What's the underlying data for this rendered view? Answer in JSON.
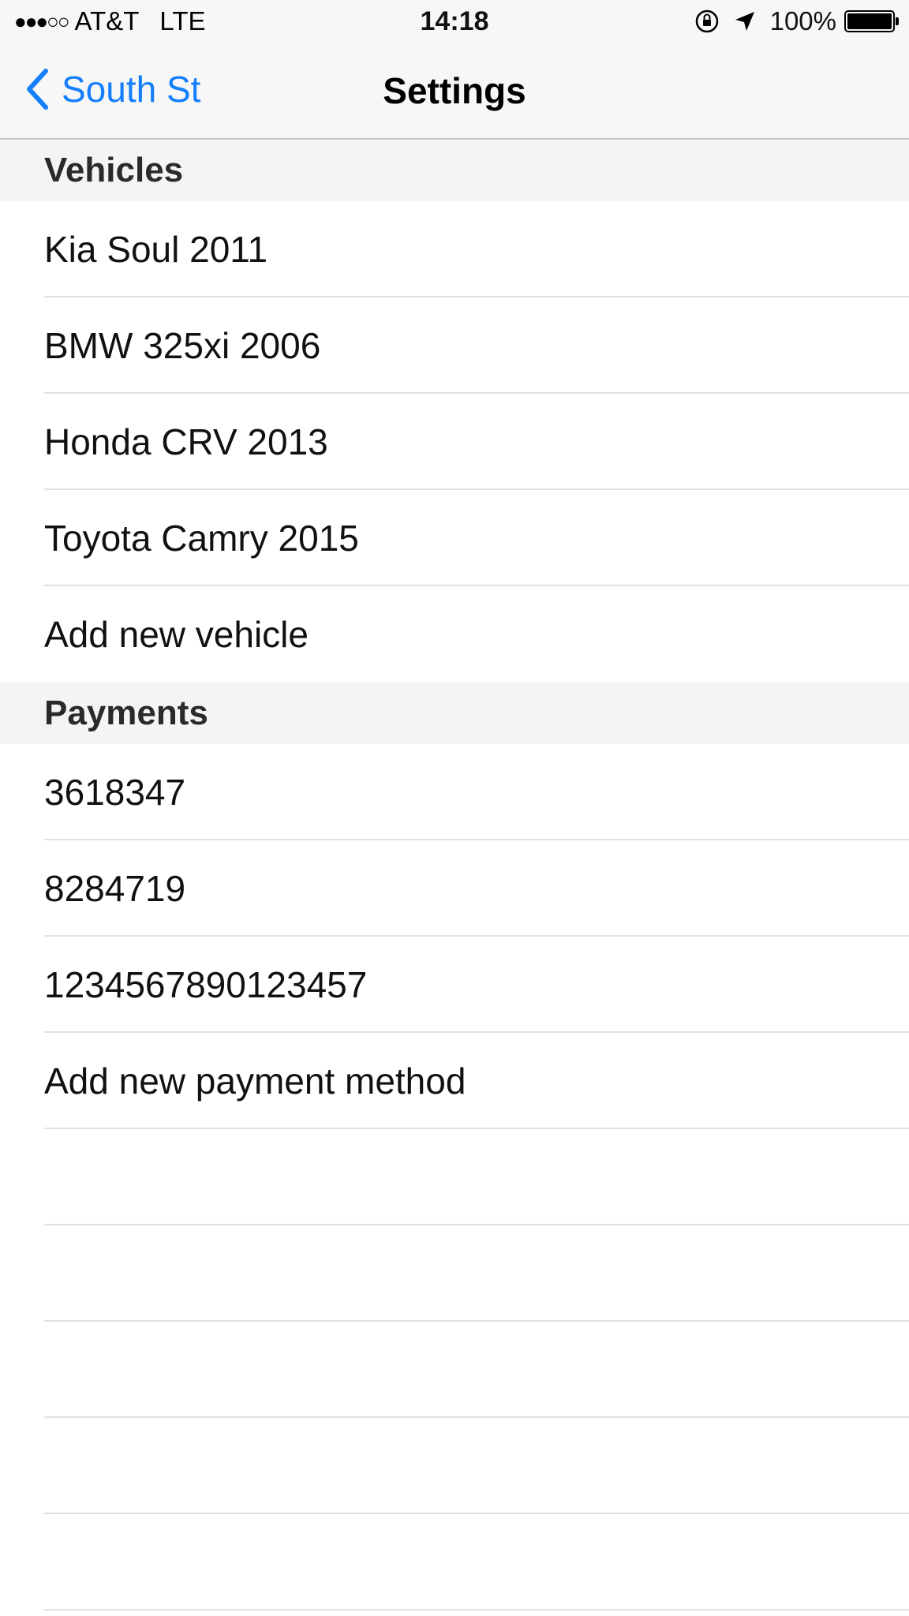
{
  "status_bar": {
    "signal": "●●●○○",
    "carrier": "AT&T",
    "network": "LTE",
    "time": "14:18",
    "battery_percent": "100%",
    "battery_level": 1.0
  },
  "nav": {
    "back_label": "South St",
    "title": "Settings",
    "accent_color": "#157efb"
  },
  "sections": {
    "vehicles": {
      "header": "Vehicles",
      "items": [
        "Kia Soul 2011",
        "BMW 325xi 2006",
        "Honda CRV 2013",
        "Toyota Camry 2015"
      ],
      "add_label": "Add new vehicle"
    },
    "payments": {
      "header": "Payments",
      "items": [
        "3618347",
        "8284719",
        "1234567890123457"
      ],
      "add_label": "Add new payment method"
    }
  },
  "icons": {
    "orientation_lock": "orientation-lock-icon",
    "location": "location-arrow-icon",
    "battery": "battery-icon",
    "back": "chevron-left-icon"
  }
}
